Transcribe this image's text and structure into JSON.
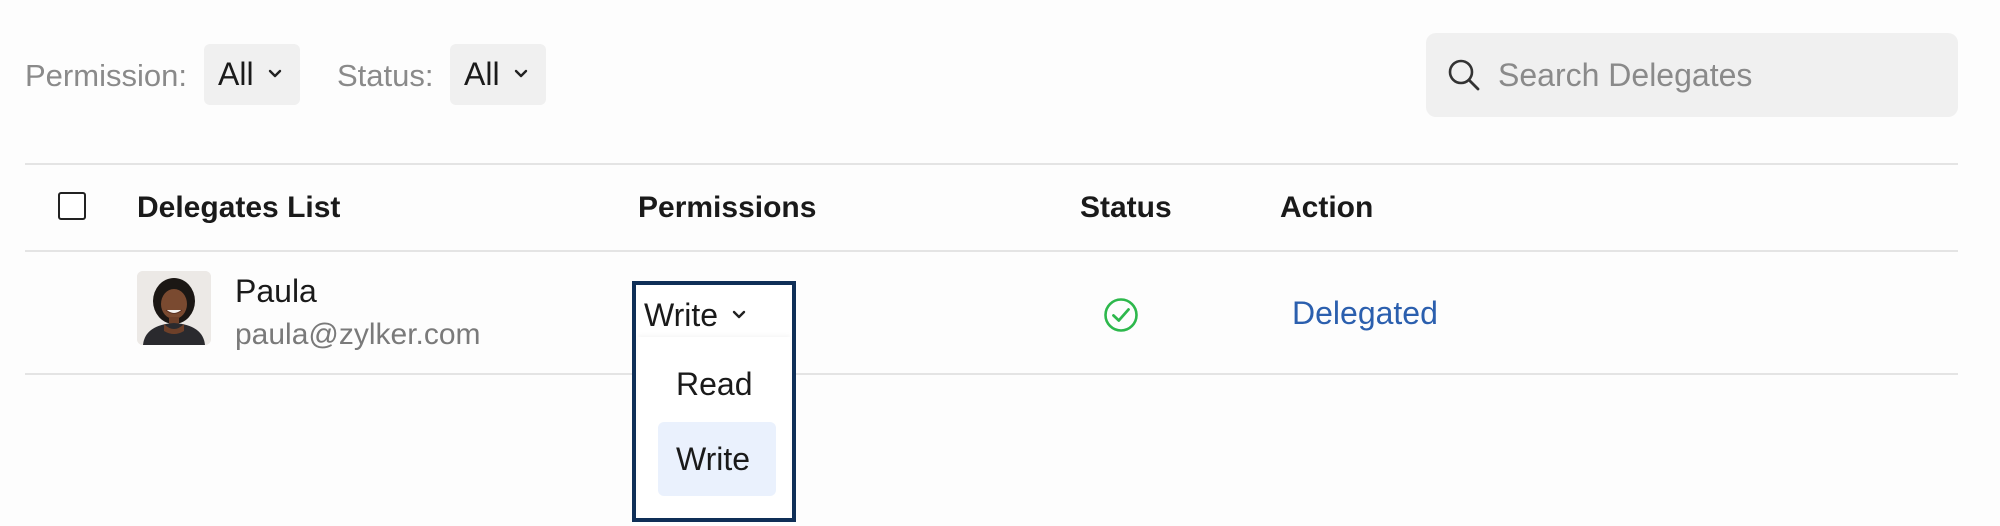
{
  "filters": {
    "permission": {
      "label": "Permission:",
      "value": "All"
    },
    "status": {
      "label": "Status:",
      "value": "All"
    }
  },
  "search": {
    "placeholder": "Search Delegates"
  },
  "table": {
    "headers": {
      "delegates": "Delegates List",
      "permissions": "Permissions",
      "status": "Status",
      "action": "Action"
    },
    "rows": [
      {
        "name": "Paula",
        "email": "paula@zylker.com",
        "permission": "Write",
        "status_icon": "check-circle-icon",
        "action": "Delegated"
      }
    ]
  },
  "permission_menu": {
    "options": [
      "Read",
      "Write"
    ],
    "selected": "Write"
  },
  "colors": {
    "accent": "#2b5fae",
    "status_ok": "#2db84c",
    "popup_border": "#0f2f57",
    "selected_option_bg": "#eaf1fd"
  }
}
